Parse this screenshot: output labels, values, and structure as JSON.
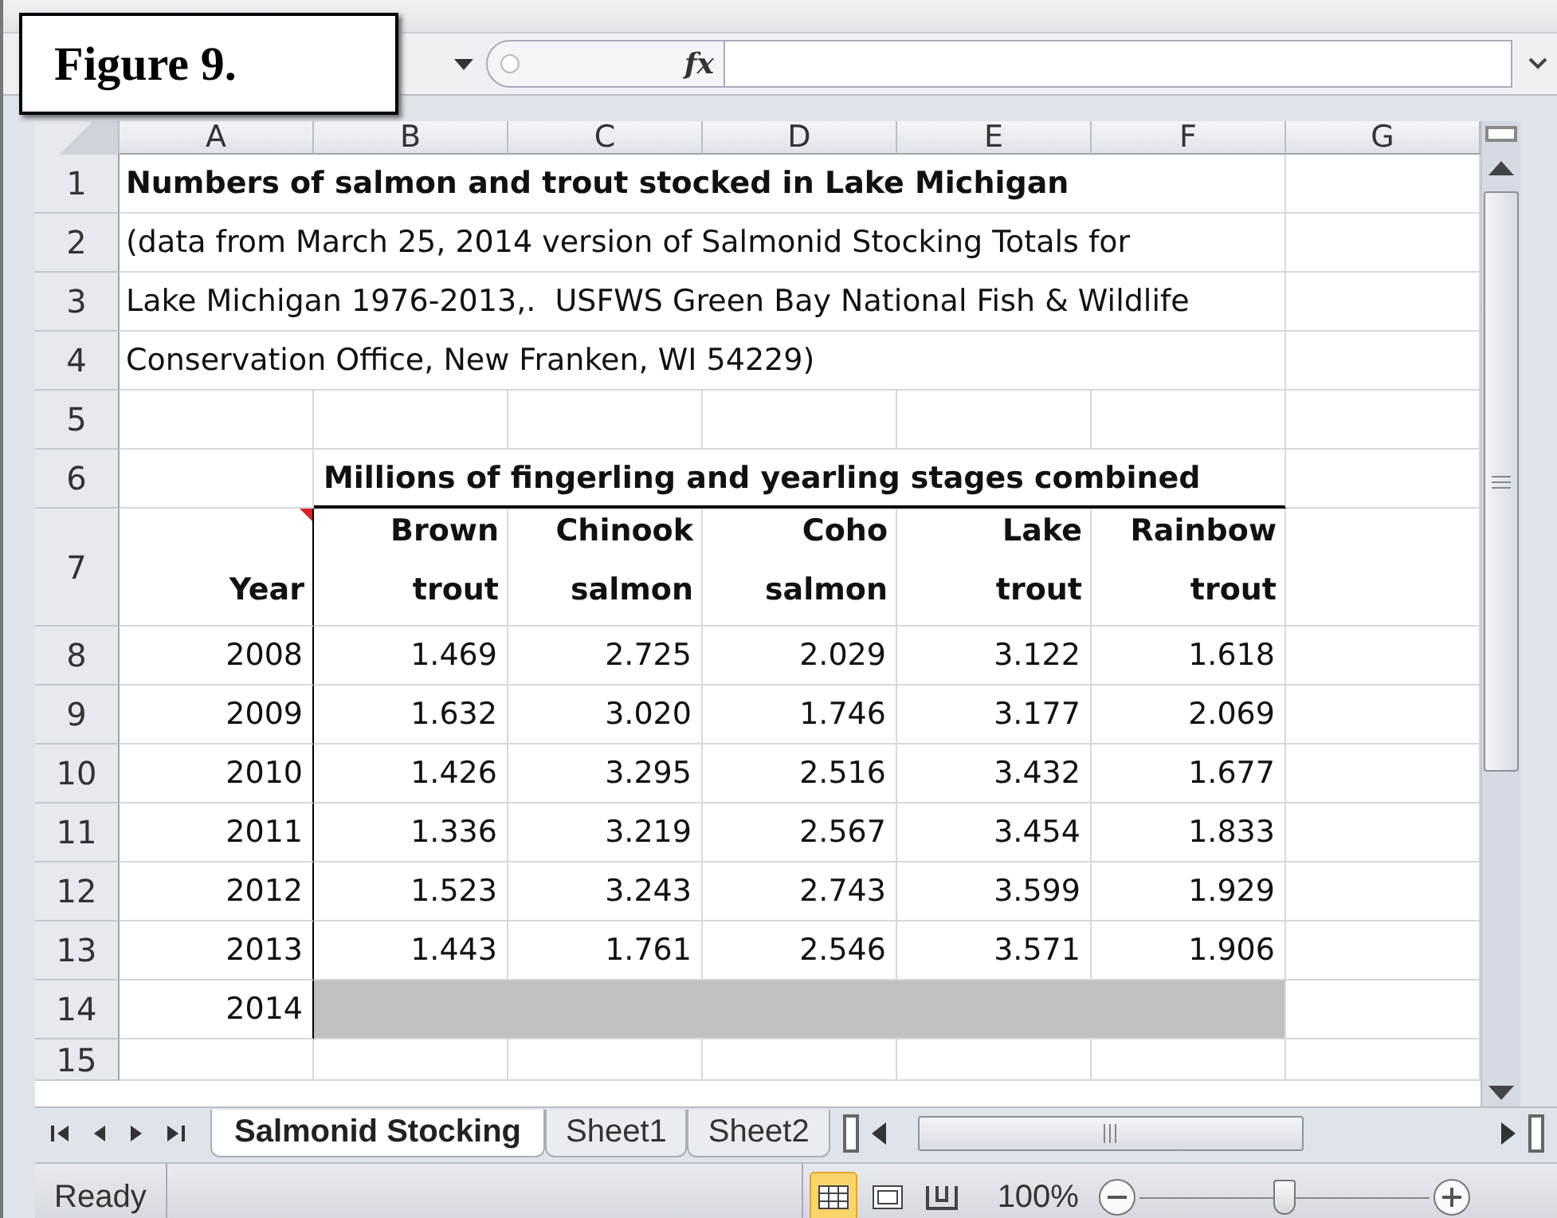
{
  "figure_label": "Figure 9.",
  "formula_bar": {
    "function_label": "fx"
  },
  "sheet": {
    "columns": [
      "A",
      "B",
      "C",
      "D",
      "E",
      "F",
      "G"
    ],
    "row_numbers": [
      "1",
      "2",
      "3",
      "4",
      "5",
      "6",
      "7",
      "8",
      "9",
      "10",
      "11",
      "12",
      "13",
      "14",
      "15"
    ],
    "title": "Numbers of salmon and trout stocked in Lake Michigan",
    "source_lines": [
      "(data from March 25, 2014 version of Salmonid Stocking Totals for",
      "Lake Michigan 1976-2013,.  USFWS Green Bay National Fish & Wildlife",
      "Conservation Office, New Franken, WI 54229)"
    ],
    "table_heading": "Millions of fingerling and yearling stages combined",
    "headers": [
      {
        "lines": [
          "Year"
        ],
        "comment": true
      },
      {
        "lines": [
          "Brown",
          "trout"
        ],
        "comment": false
      },
      {
        "lines": [
          "Chinook",
          "salmon"
        ],
        "comment": false
      },
      {
        "lines": [
          "Coho",
          "salmon"
        ],
        "comment": false
      },
      {
        "lines": [
          "Lake",
          "trout"
        ],
        "comment": false
      },
      {
        "lines": [
          "Rainbow",
          "trout"
        ],
        "comment": false
      }
    ],
    "data": [
      {
        "year": "2008",
        "values": [
          "1.469",
          "2.725",
          "2.029",
          "3.122",
          "1.618"
        ]
      },
      {
        "year": "2009",
        "values": [
          "1.632",
          "3.020",
          "1.746",
          "3.177",
          "2.069"
        ]
      },
      {
        "year": "2010",
        "values": [
          "1.426",
          "3.295",
          "2.516",
          "3.432",
          "1.677"
        ]
      },
      {
        "year": "2011",
        "values": [
          "1.336",
          "3.219",
          "2.567",
          "3.454",
          "1.833"
        ]
      },
      {
        "year": "2012",
        "values": [
          "1.523",
          "3.243",
          "2.743",
          "3.599",
          "1.929"
        ]
      },
      {
        "year": "2013",
        "values": [
          "1.443",
          "1.761",
          "2.546",
          "3.571",
          "1.906"
        ]
      }
    ],
    "pending_row": {
      "year": "2014",
      "shaded": true
    }
  },
  "tabs": [
    {
      "label": "Salmonid Stocking",
      "selected": true
    },
    {
      "label": "Sheet1",
      "selected": false
    },
    {
      "label": "Sheet2",
      "selected": false
    }
  ],
  "status_bar": {
    "status": "Ready",
    "views": [
      {
        "kind": "normal",
        "selected": true
      },
      {
        "kind": "page_layout",
        "selected": false
      },
      {
        "kind": "page_break",
        "selected": false
      }
    ],
    "zoom": "100%",
    "zoom_slider": {
      "level": 0.5
    }
  }
}
